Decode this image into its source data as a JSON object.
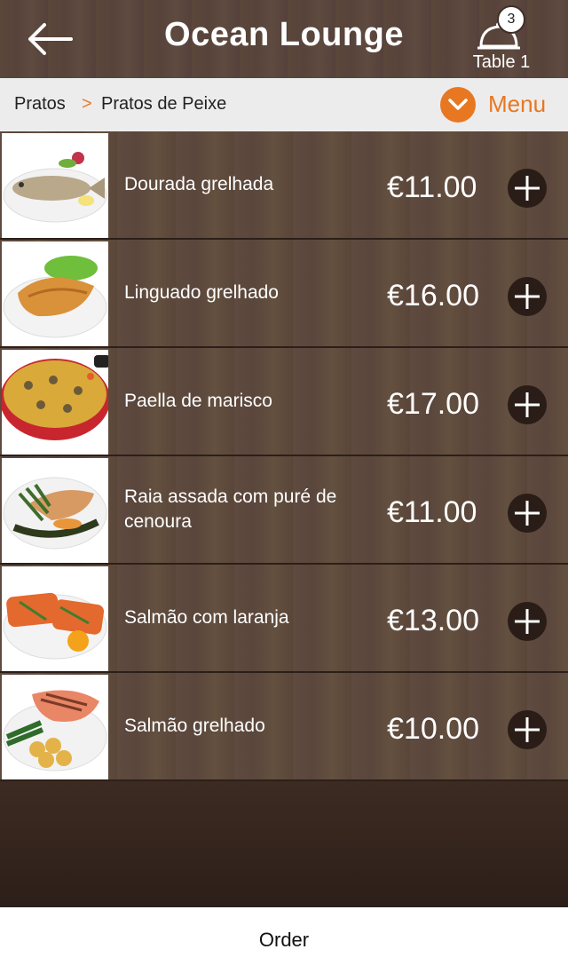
{
  "header": {
    "title": "Ocean Lounge",
    "table_label": "Table 1",
    "cart_count": "3"
  },
  "breadcrumb": {
    "root": "Pratos",
    "separator": ">",
    "current": "Pratos de Peixe"
  },
  "menu_label": "Menu",
  "items": [
    {
      "name": "Dourada grelhada",
      "price": "€11.00"
    },
    {
      "name": "Linguado grelhado",
      "price": "€16.00"
    },
    {
      "name": "Paella de marisco",
      "price": "€17.00"
    },
    {
      "name": "Raia assada com puré de cenoura",
      "price": "€11.00"
    },
    {
      "name": "Salmão com laranja",
      "price": "€13.00"
    },
    {
      "name": "Salmão grelhado",
      "price": "€10.00"
    }
  ],
  "footer": {
    "order_label": "Order"
  },
  "colors": {
    "accent": "#e87722",
    "wood": "#5a463c"
  }
}
